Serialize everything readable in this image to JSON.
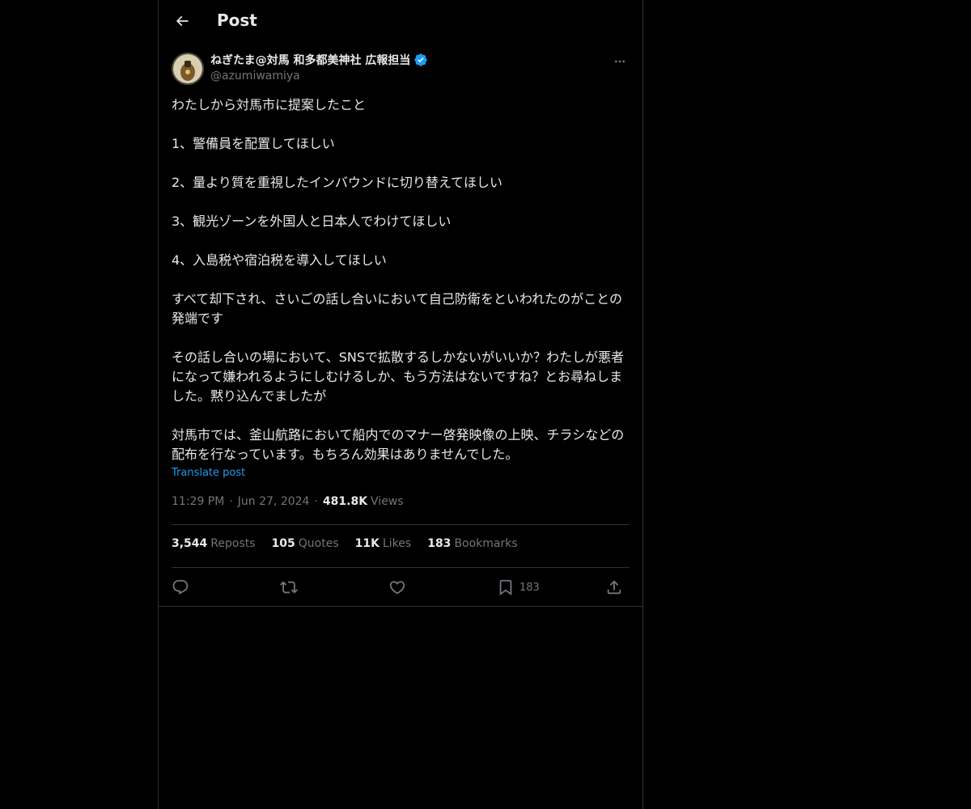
{
  "header": {
    "title": "Post",
    "back_icon": "arrow-left-icon"
  },
  "author": {
    "display_name": "ねぎたま@対馬 和多都美神社 広報担当",
    "handle": "@azumiwamiya",
    "verified_icon": "verified-badge-icon",
    "verified_color": "#1d9bf0"
  },
  "post": {
    "paragraphs": [
      "わたしから対馬市に提案したこと",
      "1、警備員を配置してほしい",
      "2、量より質を重視したインバウンドに切り替えてほしい",
      "3、観光ゾーンを外国人と日本人でわけてほしい",
      "4、入島税や宿泊税を導入してほしい",
      "すべて却下され、さいごの話し合いにおいて自己防衛をといわれたのがことの発端です",
      "その話し合いの場において、SNSで拡散するしかないがいいか？わたしが悪者になって嫌われるようにしむけるしか、もう方法はないですね？とお尋ねしました。黙り込んでましたが",
      "対馬市では、釜山航路において船内でのマナー啓発映像の上映、チラシなどの配布を行なっています。もちろん効果はありませんでした。"
    ],
    "translate_label": "Translate post",
    "time": "11:29 PM",
    "date": "Jun 27, 2024",
    "views_count": "481.8K",
    "views_label": "Views",
    "separator": "·"
  },
  "stats": {
    "reposts": {
      "count": "3,544",
      "label": "Reposts"
    },
    "quotes": {
      "count": "105",
      "label": "Quotes"
    },
    "likes": {
      "count": "11K",
      "label": "Likes"
    },
    "bookmarks": {
      "count": "183",
      "label": "Bookmarks"
    }
  },
  "actions": {
    "reply_icon": "reply-icon",
    "repost_icon": "repost-icon",
    "like_icon": "heart-icon",
    "bookmark_icon": "bookmark-icon",
    "bookmark_count": "183",
    "share_icon": "share-icon"
  },
  "colors": {
    "background": "#000000",
    "text_primary": "#e7e9ea",
    "text_secondary": "#71767b",
    "accent": "#1d9bf0",
    "border": "#2f3336"
  }
}
